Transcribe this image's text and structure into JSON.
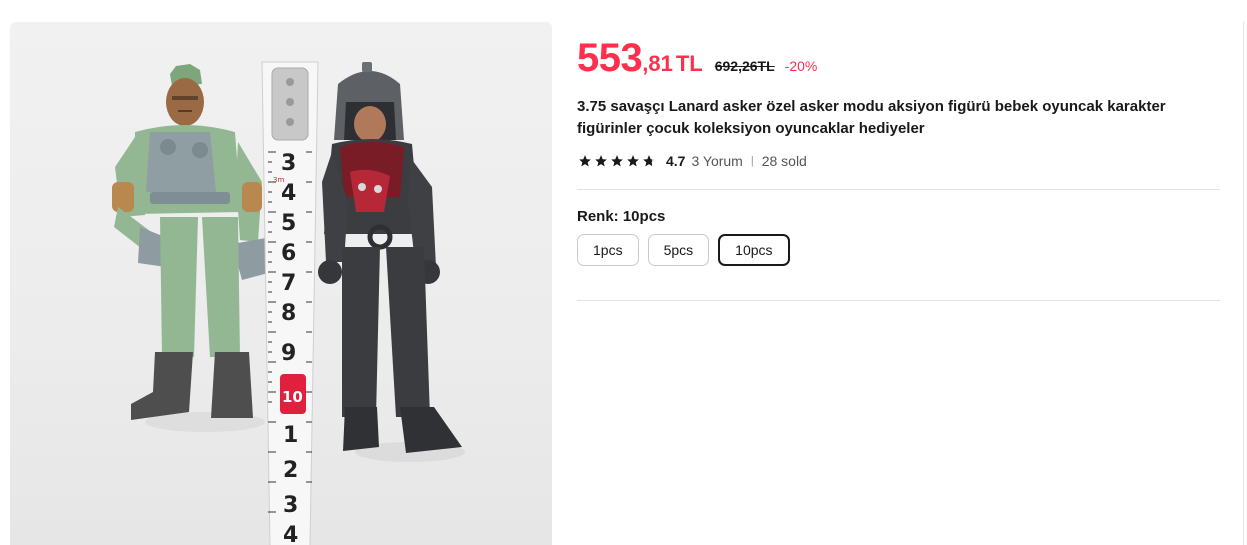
{
  "product": {
    "price_int": "553",
    "price_dec": ",81",
    "currency": "TL",
    "original_price": "692,26TL",
    "discount": "-20%",
    "title": "3.75 savaşçı Lanard asker özel asker modu aksiyon figürü bebek oyuncak karakter figürinler çocuk koleksiyon oyuncaklar hediyeler",
    "rating": "4.7",
    "rating_stars": 4.7,
    "reviews": "3 Yorum",
    "sold": "28 sold",
    "image_alt_icon": "product-photo-action-figures-with-ruler"
  },
  "variant": {
    "label": "Renk: 10pcs",
    "options": [
      "1pcs",
      "5pcs",
      "10pcs"
    ],
    "selected": "10pcs"
  },
  "ruler": {
    "marks": [
      "3",
      "4",
      "5",
      "6",
      "7",
      "8",
      "9",
      "10",
      "1",
      "2",
      "3",
      "4"
    ],
    "unit": "3m"
  },
  "colors": {
    "price": "#ff2f4d",
    "text": "#191919"
  }
}
